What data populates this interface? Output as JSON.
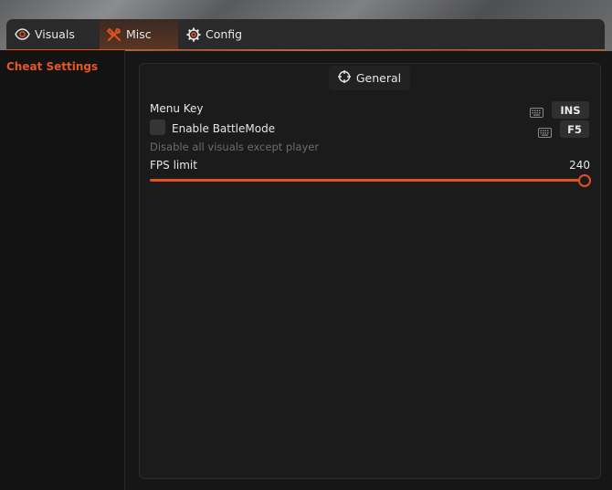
{
  "tabs": [
    {
      "label": "Visuals",
      "icon": "eye-icon",
      "active": false
    },
    {
      "label": "Misc",
      "icon": "tools-icon",
      "active": true
    },
    {
      "label": "Config",
      "icon": "gear-icon",
      "active": false
    }
  ],
  "sidebar": {
    "items": [
      {
        "label": "Cheat Settings",
        "active": true
      }
    ]
  },
  "panel": {
    "title": "General",
    "title_icon": "crosshair-icon",
    "menu_key": {
      "label": "Menu Key",
      "key": "INS",
      "icon": "keyboard-icon"
    },
    "battle_mode": {
      "label": "Enable BattleMode",
      "checked": false,
      "key": "F5",
      "icon": "keyboard-icon",
      "description": "Disable all visuals except player"
    },
    "fps_limit": {
      "label": "FPS limit",
      "value": "240",
      "fraction": 1.0
    }
  },
  "colors": {
    "accent": "#e0521f",
    "background": "#161616",
    "panel": "#1b1b1b",
    "muted": "#6c6c6c"
  }
}
